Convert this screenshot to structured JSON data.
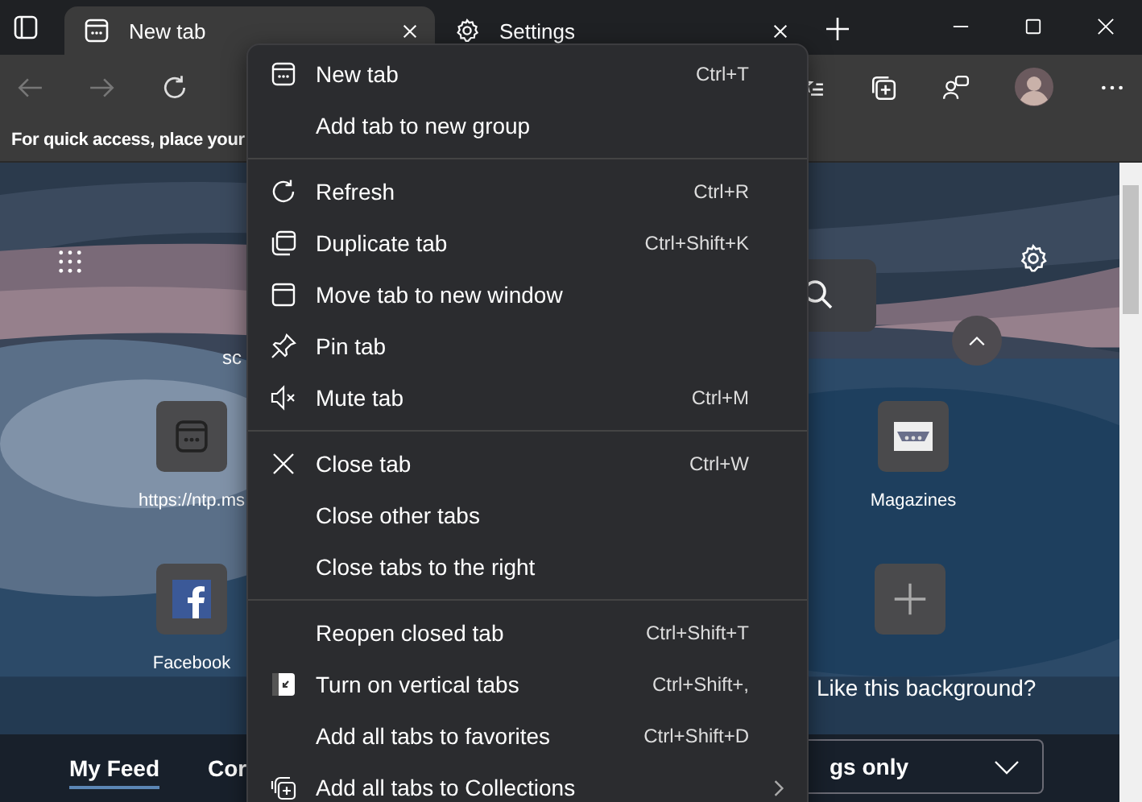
{
  "tabs": [
    {
      "title": "New tab",
      "selected": true,
      "kind": "page"
    },
    {
      "title": "Settings",
      "selected": false,
      "kind": "settings"
    }
  ],
  "favorites_bar": {
    "hint": "For quick access, place your"
  },
  "new_tab_page": {
    "search_fragment": "sc",
    "tiles": [
      {
        "label": "https://ntp.ms",
        "kind": "page"
      },
      {
        "label": "Facebook",
        "kind": "facebook"
      },
      {
        "label": "Magazines",
        "kind": "magazine"
      },
      {
        "kind": "add"
      }
    ],
    "background_prompt": "Like this background?",
    "feed_tabs": [
      {
        "label": "My Feed",
        "selected": true
      },
      {
        "label": "Cor",
        "selected": false
      }
    ],
    "feed_dropdown": {
      "value": "gs only"
    }
  },
  "context_menu": {
    "sections": [
      [
        {
          "label": "New tab",
          "shortcut": "Ctrl+T",
          "kind": "new-tab"
        },
        {
          "label": "Add tab to new group",
          "kind": "plain"
        }
      ],
      [
        {
          "label": "Refresh",
          "shortcut": "Ctrl+R",
          "kind": "refresh"
        },
        {
          "label": "Duplicate tab",
          "shortcut": "Ctrl+Shift+K",
          "kind": "duplicate"
        },
        {
          "label": "Move tab to new window",
          "kind": "window"
        },
        {
          "label": "Pin tab",
          "kind": "pin"
        },
        {
          "label": "Mute tab",
          "shortcut": "Ctrl+M",
          "kind": "mute"
        }
      ],
      [
        {
          "label": "Close tab",
          "shortcut": "Ctrl+W",
          "kind": "close"
        },
        {
          "label": "Close other tabs",
          "kind": "plain"
        },
        {
          "label": "Close tabs to the right",
          "kind": "plain"
        }
      ],
      [
        {
          "label": "Reopen closed tab",
          "shortcut": "Ctrl+Shift+T",
          "kind": "plain"
        },
        {
          "label": "Turn on vertical tabs",
          "shortcut": "Ctrl+Shift+,",
          "kind": "vertical"
        },
        {
          "label": "Add all tabs to favorites",
          "shortcut": "Ctrl+Shift+D",
          "kind": "plain"
        },
        {
          "label": "Add all tabs to Collections",
          "kind": "collections"
        }
      ]
    ]
  }
}
